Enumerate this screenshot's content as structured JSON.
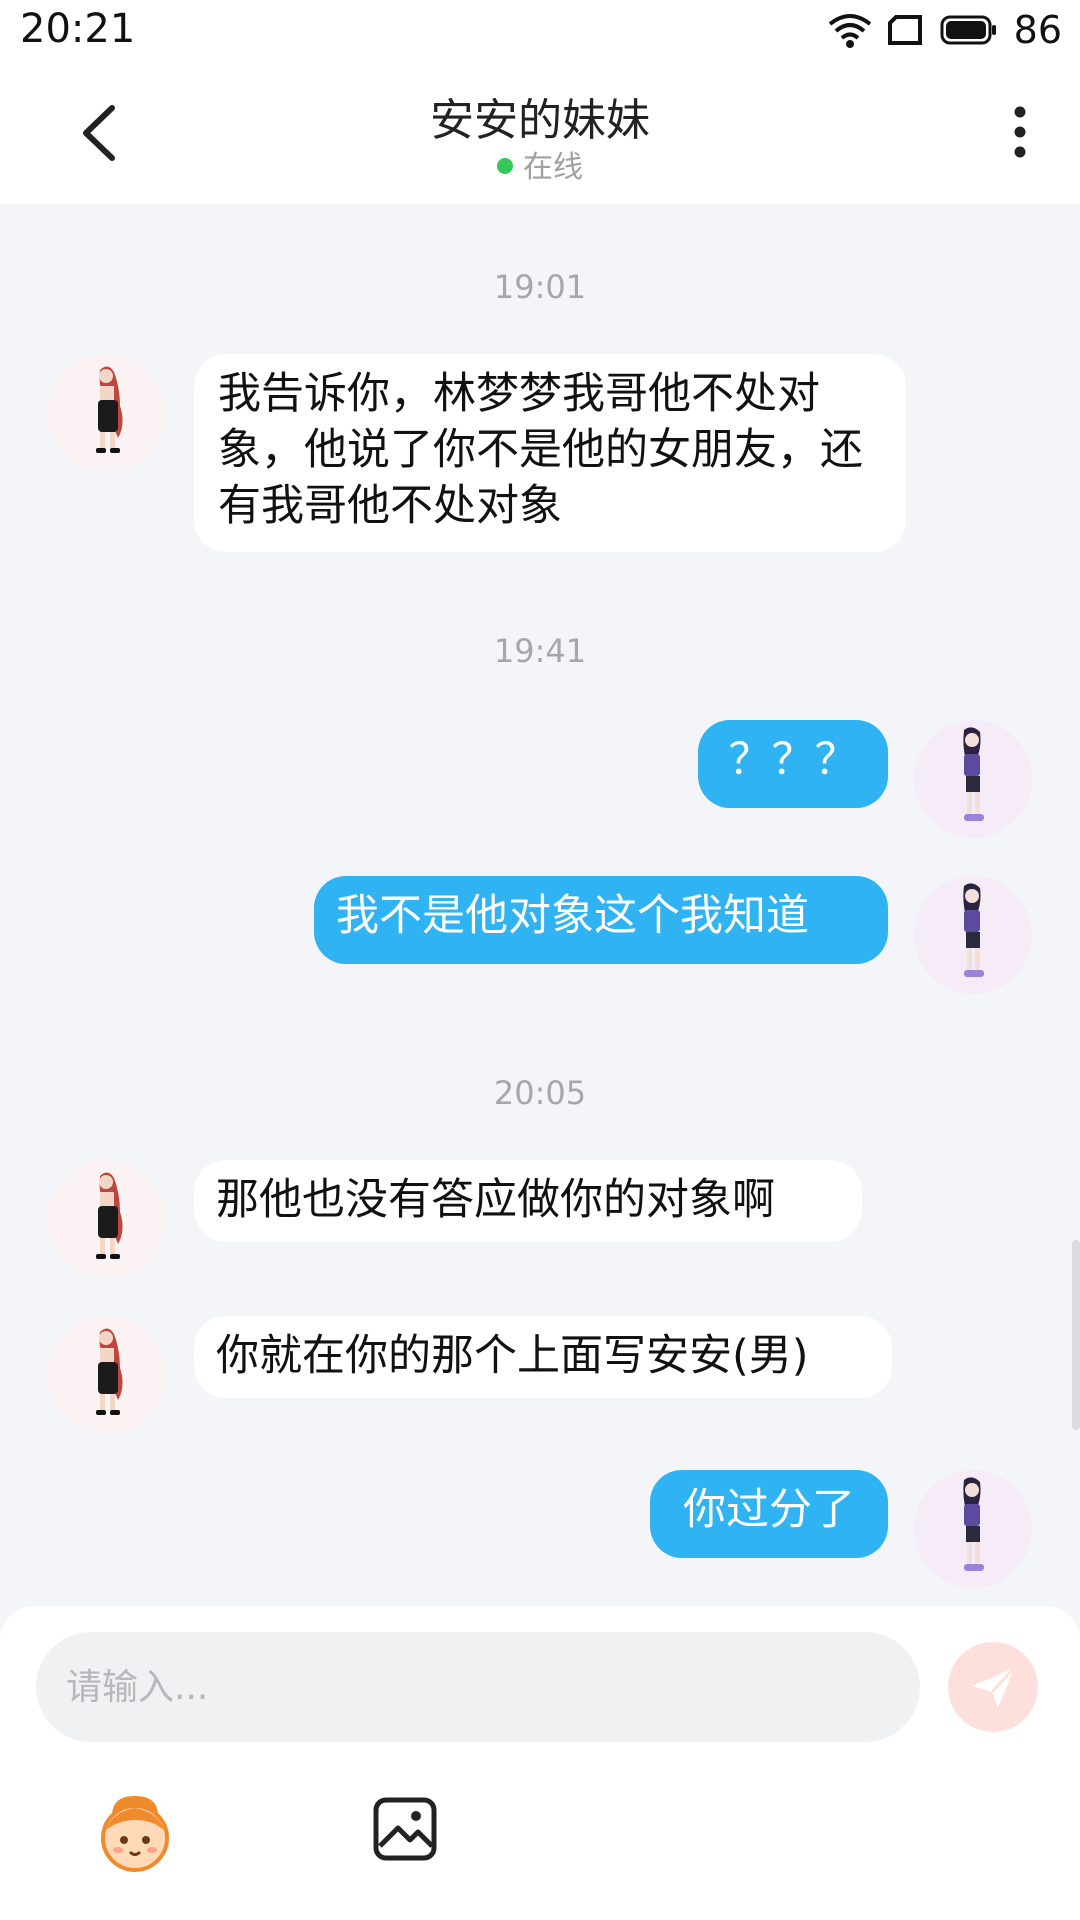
{
  "status_bar": {
    "time": "20:21",
    "battery": "86"
  },
  "header": {
    "title": "安安的妹妹",
    "status": "在线"
  },
  "messages": {
    "ts1": "19:01",
    "m1": "我告诉你，林梦梦我哥他不处对象，他说了你不是他的女朋友，还有我哥他不处对象",
    "ts2": "19:41",
    "m2": "？？？",
    "m3": "我不是他对象这个我知道",
    "ts3": "20:05",
    "m4": "那他也没有答应做你的对象啊",
    "m5": "你就在你的那个上面写安安(男)",
    "m6": "你过分了"
  },
  "composer": {
    "placeholder": "请输入..."
  },
  "colors": {
    "outgoing_bubble": "#2fb3f3",
    "online_dot": "#34c759",
    "send_button": "#fde0dc"
  },
  "icons": [
    "back-icon",
    "more-icon",
    "wifi-icon",
    "sim-icon",
    "battery-icon",
    "send-icon",
    "emoji-icon",
    "image-icon"
  ]
}
